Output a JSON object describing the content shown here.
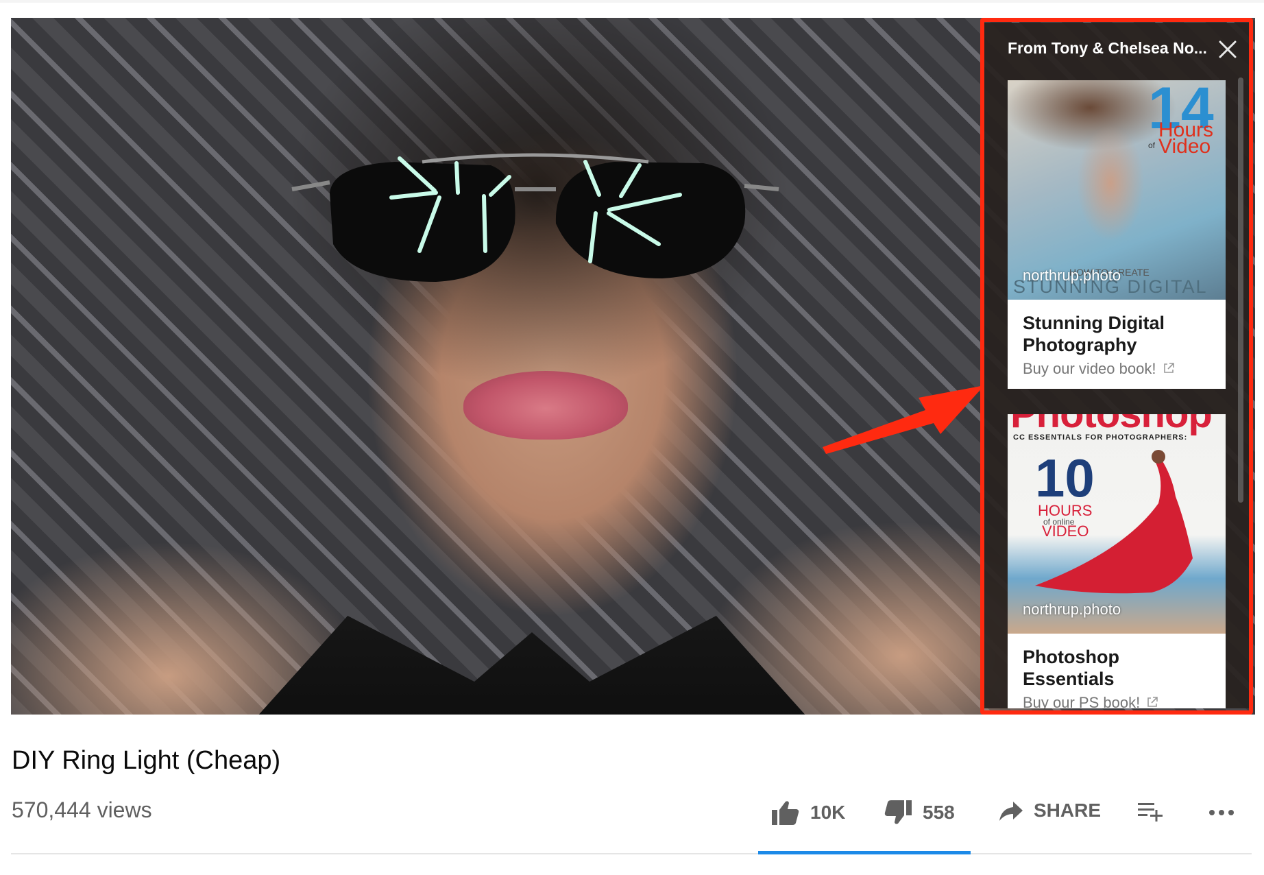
{
  "suggestion_panel": {
    "title": "From Tony & Chelsea No...",
    "cards": [
      {
        "watermark": "northrup.photo",
        "cover_badge": "14",
        "cover_line1": "Hours",
        "cover_line2": "Video",
        "cover_of": "of",
        "cover_text_a": "HOW TO CREATE",
        "cover_text_b": "STUNNING DIGITAL",
        "title": "Stunning Digital Photography",
        "subtitle": "Buy our video book!"
      },
      {
        "watermark": "northrup.photo",
        "cover_masthead": "Photoshop",
        "cover_tagline": "CC ESSENTIALS FOR PHOTOGRAPHERS:",
        "cover_badge": "10",
        "cover_line1": "HOURS",
        "cover_of": "of online",
        "cover_line2": "VIDEO",
        "title": "Photoshop Essentials",
        "subtitle": "Buy our PS book!"
      }
    ]
  },
  "video": {
    "title": "DIY Ring Light (Cheap)",
    "views": "570,444 views"
  },
  "actions": {
    "like_count": "10K",
    "dislike_count": "558",
    "share_label": "SHARE"
  },
  "colors": {
    "highlight": "#ff2a10",
    "accent_underline": "#1c8ae8"
  }
}
